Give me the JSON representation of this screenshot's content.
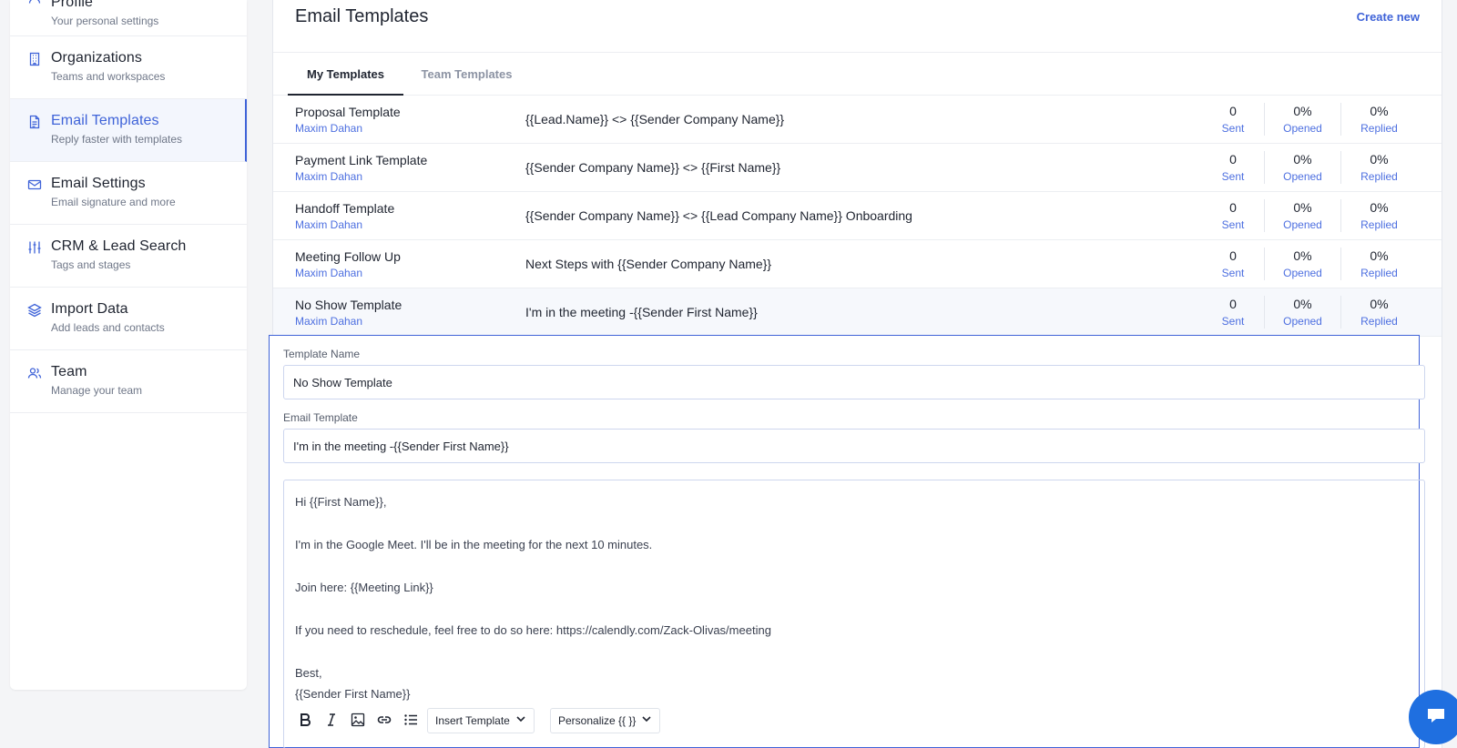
{
  "sidebar": {
    "items": [
      {
        "title": "Profile",
        "subtitle": "Your personal settings",
        "icon": "user-icon"
      },
      {
        "title": "Organizations",
        "subtitle": "Teams and workspaces",
        "icon": "building-icon"
      },
      {
        "title": "Email Templates",
        "subtitle": "Reply faster with templates",
        "icon": "document-icon"
      },
      {
        "title": "Email Settings",
        "subtitle": "Email signature and more",
        "icon": "mail-icon"
      },
      {
        "title": "CRM & Lead Search",
        "subtitle": "Tags and stages",
        "icon": "sliders-icon"
      },
      {
        "title": "Import Data",
        "subtitle": "Add leads and contacts",
        "icon": "layers-icon"
      },
      {
        "title": "Team",
        "subtitle": "Manage your team",
        "icon": "users-icon"
      }
    ]
  },
  "header": {
    "title": "Email Templates",
    "create_new": "Create new"
  },
  "tabs": [
    {
      "label": "My Templates"
    },
    {
      "label": "Team Templates"
    }
  ],
  "templates": [
    {
      "name": "Proposal Template",
      "owner": "Maxim Dahan",
      "subject": "{{Lead.Name}} <> {{Sender Company Name}}",
      "sent": "0",
      "sent_label": "Sent",
      "opened": "0%",
      "opened_label": "Opened",
      "replied": "0%",
      "replied_label": "Replied"
    },
    {
      "name": "Payment Link Template",
      "owner": "Maxim Dahan",
      "subject": "{{Sender Company Name}} <> {{First Name}}",
      "sent": "0",
      "sent_label": "Sent",
      "opened": "0%",
      "opened_label": "Opened",
      "replied": "0%",
      "replied_label": "Replied"
    },
    {
      "name": "Handoff Template",
      "owner": "Maxim Dahan",
      "subject": "{{Sender Company Name}} <> {{Lead Company Name}} Onboarding",
      "sent": "0",
      "sent_label": "Sent",
      "opened": "0%",
      "opened_label": "Opened",
      "replied": "0%",
      "replied_label": "Replied"
    },
    {
      "name": "Meeting Follow Up",
      "owner": "Maxim Dahan",
      "subject": "Next Steps with {{Sender Company Name}}",
      "sent": "0",
      "sent_label": "Sent",
      "opened": "0%",
      "opened_label": "Opened",
      "replied": "0%",
      "replied_label": "Replied"
    },
    {
      "name": "No Show Template",
      "owner": "Maxim Dahan",
      "subject": "I'm in the meeting -{{Sender First Name}}",
      "sent": "0",
      "sent_label": "Sent",
      "opened": "0%",
      "opened_label": "Opened",
      "replied": "0%",
      "replied_label": "Replied"
    }
  ],
  "editor": {
    "template_name_label": "Template Name",
    "template_name_value": "No Show Template",
    "email_template_label": "Email Template",
    "email_subject_value": "I'm in the meeting -{{Sender First Name}}",
    "body_lines": [
      "Hi {{First Name}},",
      "I'm in the Google Meet. I'll be in the meeting for the next 10 minutes.",
      "Join here: {{Meeting Link}}",
      "If you need to reschedule, feel free to do so here: https://calendly.com/Zack-Olivas/meeting",
      "Best,",
      "{{Sender First Name}}"
    ],
    "toolbar": {
      "insert_template": "Insert Template",
      "personalize": "Personalize {{ }}"
    }
  },
  "colors": {
    "accent": "#3f63d8",
    "chat": "#1f6fe0"
  }
}
